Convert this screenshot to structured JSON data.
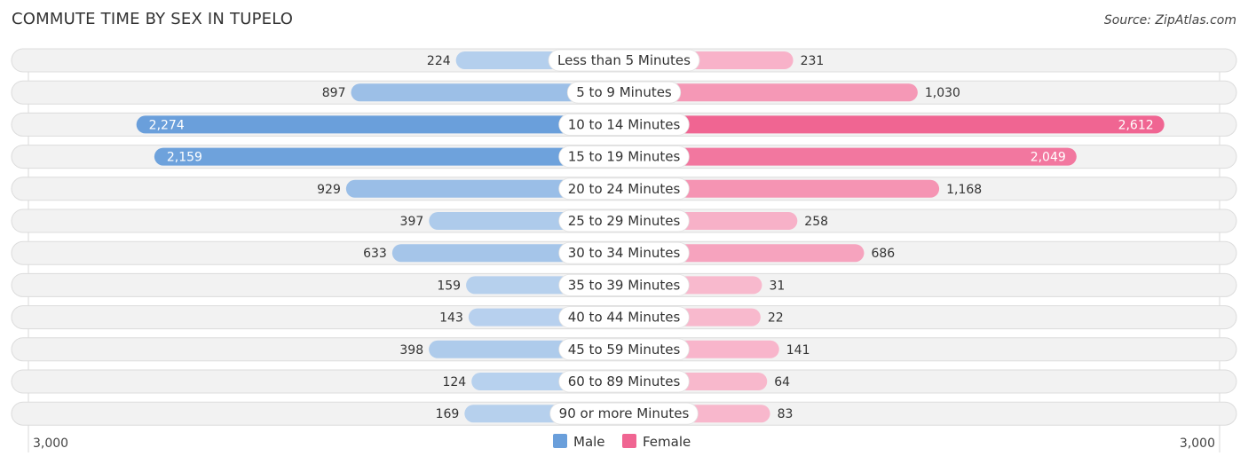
{
  "title": "COMMUTE TIME BY SEX IN TUPELO",
  "source": "Source: ZipAtlas.com",
  "chart_data": {
    "type": "bar",
    "orientation": "horizontal-diverging",
    "title": "COMMUTE TIME BY SEX IN TUPELO",
    "categories": [
      "Less than 5 Minutes",
      "5 to 9 Minutes",
      "10 to 14 Minutes",
      "15 to 19 Minutes",
      "20 to 24 Minutes",
      "25 to 29 Minutes",
      "30 to 34 Minutes",
      "35 to 39 Minutes",
      "40 to 44 Minutes",
      "45 to 59 Minutes",
      "60 to 89 Minutes",
      "90 or more Minutes"
    ],
    "series": [
      {
        "name": "Male",
        "side": "left",
        "color": "#6a9fdb",
        "values": [
          224,
          897,
          2274,
          2159,
          929,
          397,
          633,
          159,
          143,
          398,
          124,
          169
        ],
        "labels": [
          "224",
          "897",
          "2,274",
          "2,159",
          "929",
          "397",
          "633",
          "159",
          "143",
          "398",
          "124",
          "169"
        ]
      },
      {
        "name": "Female",
        "side": "right",
        "color": "#f06592",
        "values": [
          231,
          1030,
          2612,
          2049,
          1168,
          258,
          686,
          31,
          22,
          141,
          64,
          83
        ],
        "labels": [
          "231",
          "1,030",
          "2,612",
          "2,049",
          "1,168",
          "258",
          "686",
          "31",
          "22",
          "141",
          "64",
          "83"
        ]
      }
    ],
    "axis": {
      "left_label": "3,000",
      "right_label": "3,000",
      "max": 3000
    },
    "legend": {
      "position": "bottom-center",
      "items": [
        {
          "name": "Male",
          "color": "#6a9fdb"
        },
        {
          "name": "Female",
          "color": "#f06592"
        }
      ]
    }
  }
}
